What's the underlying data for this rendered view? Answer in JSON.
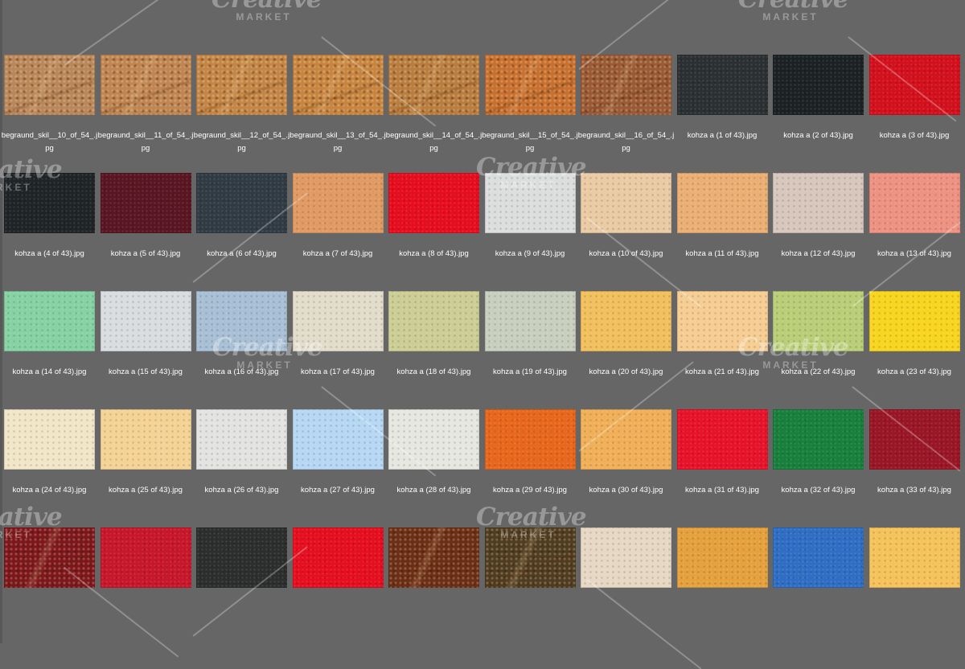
{
  "files": [
    {
      "name": "begraund_skil__10_of_54_.jpg",
      "color": "#b9875a",
      "texture": "distressed"
    },
    {
      "name": "begraund_skil__11_of_54_.jpg",
      "color": "#bf8552",
      "texture": "distressed"
    },
    {
      "name": "begraund_skil__12_of_54_.jpg",
      "color": "#c48646",
      "texture": "distressed"
    },
    {
      "name": "begraund_skil__13_of_54_.jpg",
      "color": "#c78540",
      "texture": "distressed"
    },
    {
      "name": "begraund_skil__14_of_54_.jpg",
      "color": "#b97d3f",
      "texture": "distressed"
    },
    {
      "name": "begraund_skil__15_of_54_.jpg",
      "color": "#c8702f",
      "texture": "distressed"
    },
    {
      "name": "begraund_skil__16_of_54_.jpg",
      "color": "#9a5a35",
      "texture": "distressed"
    },
    {
      "name": "kohza a (1 of 43).jpg",
      "color": "#2b3032",
      "texture": "smooth"
    },
    {
      "name": "kohza a (2 of 43).jpg",
      "color": "#1c2124",
      "texture": "smooth"
    },
    {
      "name": "kohza a (3 of 43).jpg",
      "color": "#d3101c",
      "texture": "smooth"
    },
    {
      "name": "kohza a (4 of 43).jpg",
      "color": "#1f2427",
      "texture": "smooth"
    },
    {
      "name": "kohza a (5 of 43).jpg",
      "color": "#5a1522",
      "texture": "smooth"
    },
    {
      "name": "kohza a (6 of 43).jpg",
      "color": "#313b44",
      "texture": "smooth"
    },
    {
      "name": "kohza a (7 of 43).jpg",
      "color": "#e19a62",
      "texture": "smooth"
    },
    {
      "name": "kohza a (8 of 43).jpg",
      "color": "#e70d1e",
      "texture": "smooth"
    },
    {
      "name": "kohza a (9 of 43).jpg",
      "color": "#dcdedd",
      "texture": "smooth"
    },
    {
      "name": "kohza a (10 of 43).jpg",
      "color": "#ebcba4",
      "texture": "smooth"
    },
    {
      "name": "kohza a (11 of 43).jpg",
      "color": "#ecaf73",
      "texture": "smooth"
    },
    {
      "name": "kohza a (12 of 43).jpg",
      "color": "#d8c7bd",
      "texture": "smooth"
    },
    {
      "name": "kohza a (13 of 43).jpg",
      "color": "#ef9282",
      "texture": "smooth"
    },
    {
      "name": "kohza a (14 of 43).jpg",
      "color": "#86d2a4",
      "texture": "smooth"
    },
    {
      "name": "kohza a (15 of 43).jpg",
      "color": "#d9dde0",
      "texture": "smooth"
    },
    {
      "name": "kohza a (16 of 43).jpg",
      "color": "#a8bfd6",
      "texture": "smooth"
    },
    {
      "name": "kohza a (17 of 43).jpg",
      "color": "#e2dccb",
      "texture": "smooth"
    },
    {
      "name": "kohza a (18 of 43).jpg",
      "color": "#ccce95",
      "texture": "smooth"
    },
    {
      "name": "kohza a (19 of 43).jpg",
      "color": "#c9cfbf",
      "texture": "smooth"
    },
    {
      "name": "kohza a (20 of 43).jpg",
      "color": "#f2c05c",
      "texture": "smooth"
    },
    {
      "name": "kohza a (21 of 43).jpg",
      "color": "#f6cd92",
      "texture": "smooth"
    },
    {
      "name": "kohza a (22 of 43).jpg",
      "color": "#b9ce76",
      "texture": "smooth"
    },
    {
      "name": "kohza a (23 of 43).jpg",
      "color": "#f8d51f",
      "texture": "smooth"
    },
    {
      "name": "kohza a (24 of 43).jpg",
      "color": "#f1e6c8",
      "texture": "smooth"
    },
    {
      "name": "kohza a (25 of 43).jpg",
      "color": "#f5d395",
      "texture": "smooth"
    },
    {
      "name": "kohza a (26 of 43).jpg",
      "color": "#e3e4e2",
      "texture": "smooth"
    },
    {
      "name": "kohza a (27 of 43).jpg",
      "color": "#b6d8f4",
      "texture": "smooth"
    },
    {
      "name": "kohza a (28 of 43).jpg",
      "color": "#e6e7e1",
      "texture": "smooth"
    },
    {
      "name": "kohza a (29 of 43).jpg",
      "color": "#e9671c",
      "texture": "smooth"
    },
    {
      "name": "kohza a (30 of 43).jpg",
      "color": "#f1b058",
      "texture": "smooth"
    },
    {
      "name": "kohza a (31 of 43).jpg",
      "color": "#e8132a",
      "texture": "smooth"
    },
    {
      "name": "kohza a (32 of 43).jpg",
      "color": "#18803c",
      "texture": "smooth"
    },
    {
      "name": "kohza a (33 of 43).jpg",
      "color": "#9a1525",
      "texture": "smooth"
    },
    {
      "name": "",
      "color": "#7d161d",
      "texture": "distressed"
    },
    {
      "name": "",
      "color": "#c8172a",
      "texture": "smooth"
    },
    {
      "name": "",
      "color": "#2b2e2d",
      "texture": "smooth"
    },
    {
      "name": "",
      "color": "#e60e1f",
      "texture": "smooth"
    },
    {
      "name": "",
      "color": "#6b2e17",
      "texture": "distressed"
    },
    {
      "name": "",
      "color": "#4f3d22",
      "texture": "distressed"
    },
    {
      "name": "",
      "color": "#e7d8c4",
      "texture": "smooth"
    },
    {
      "name": "",
      "color": "#e6a13d",
      "texture": "smooth"
    },
    {
      "name": "",
      "color": "#2f6ec4",
      "texture": "smooth"
    },
    {
      "name": "",
      "color": "#f6c35a",
      "texture": "smooth"
    }
  ],
  "watermark": {
    "script": "Creative",
    "sub": "MARKET"
  }
}
